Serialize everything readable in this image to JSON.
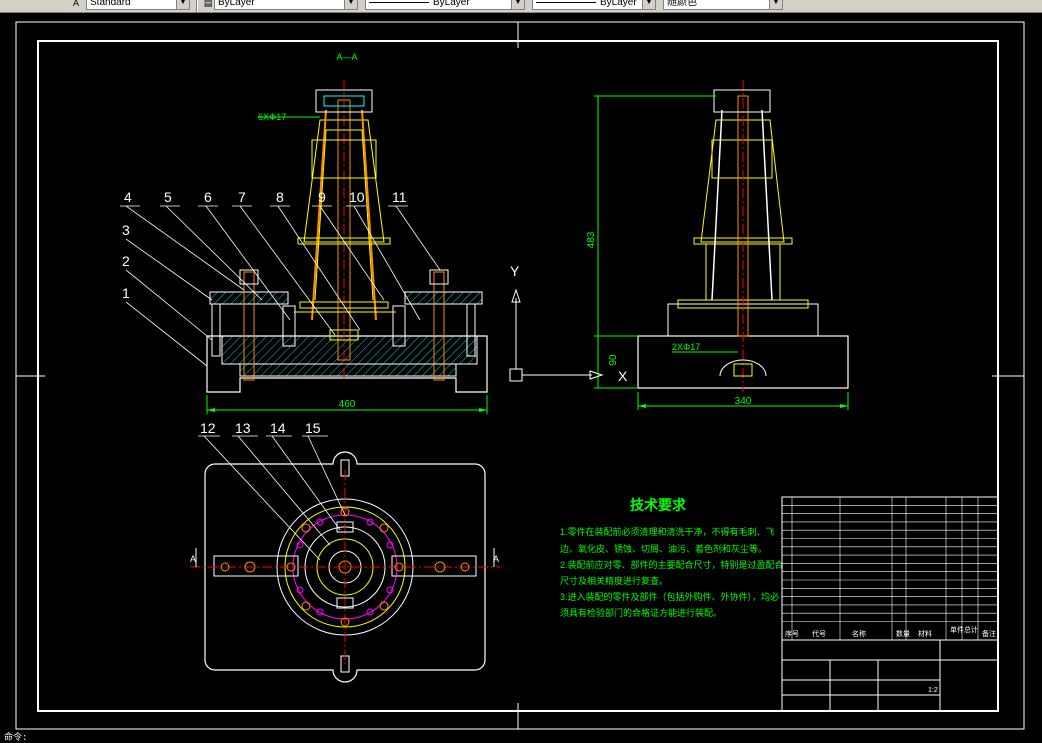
{
  "toolbar": {
    "style_value": "Standard",
    "layer_value": "ByLayer",
    "linetype_value": "ByLayer",
    "lineweight_value": "ByLayer",
    "color_value": "随颜色"
  },
  "drawing": {
    "section_label": "A—A",
    "dim_hole_top": "6XΦ17",
    "dim_hole_side": "2XΦ17",
    "dim_width_front": "460",
    "dim_width_side": "340",
    "dim_height_side": "483",
    "dim_base_side": "90",
    "part_numbers_top": [
      "4",
      "5",
      "6",
      "7",
      "8",
      "9",
      "10",
      "11"
    ],
    "part_numbers_left": [
      "3",
      "2",
      "1"
    ],
    "part_numbers_plan": [
      "12",
      "13",
      "14",
      "15"
    ],
    "axis_y": "Y",
    "axis_x": "X",
    "section_marker_left": "A",
    "section_marker_right": "A"
  },
  "tech_requirements": {
    "title": "技术要求",
    "line1": "1.零件在装配前必须清理和清洗干净，不得有毛刺、飞",
    "line2": "边、氧化皮、锈蚀、切屑、油污、着色剂和灰尘等。",
    "line3": "2.装配前应对零、部件的主要配合尺寸，特别是过盈配合",
    "line4": "尺寸及相关精度进行复查。",
    "line5": "3.进入装配的零件及部件（包括外购件、外协件），均必",
    "line6": "须具有检验部门的合格证方能进行装配。"
  },
  "title_block": {
    "header_cols": [
      "序号",
      "代号",
      "名称",
      "数量",
      "材料",
      "单件",
      "总计",
      "备注"
    ],
    "scale": "1:2"
  },
  "status": {
    "coords": "命令:"
  }
}
